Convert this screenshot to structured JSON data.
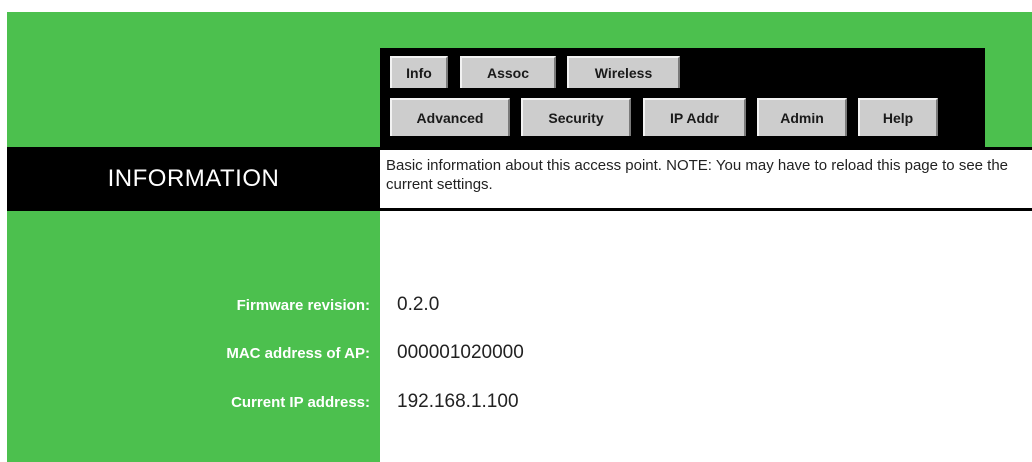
{
  "tabs": {
    "row1": [
      "Info",
      "Assoc",
      "Wireless"
    ],
    "row2": [
      "Advanced",
      "Security",
      "IP Addr",
      "Admin",
      "Help"
    ]
  },
  "header": {
    "title": "INFORMATION",
    "description": "Basic information about this access point. NOTE: You may have to reload this page to see the current settings."
  },
  "info_rows": [
    {
      "label": "Firmware revision:",
      "value": "0.2.0"
    },
    {
      "label": "MAC address of AP:",
      "value": "000001020000"
    },
    {
      "label": "Current IP address:",
      "value": "192.168.1.100"
    }
  ],
  "colors": {
    "green": "#4cc04e",
    "black": "#000000",
    "tab_gray": "#cdcdcd"
  }
}
